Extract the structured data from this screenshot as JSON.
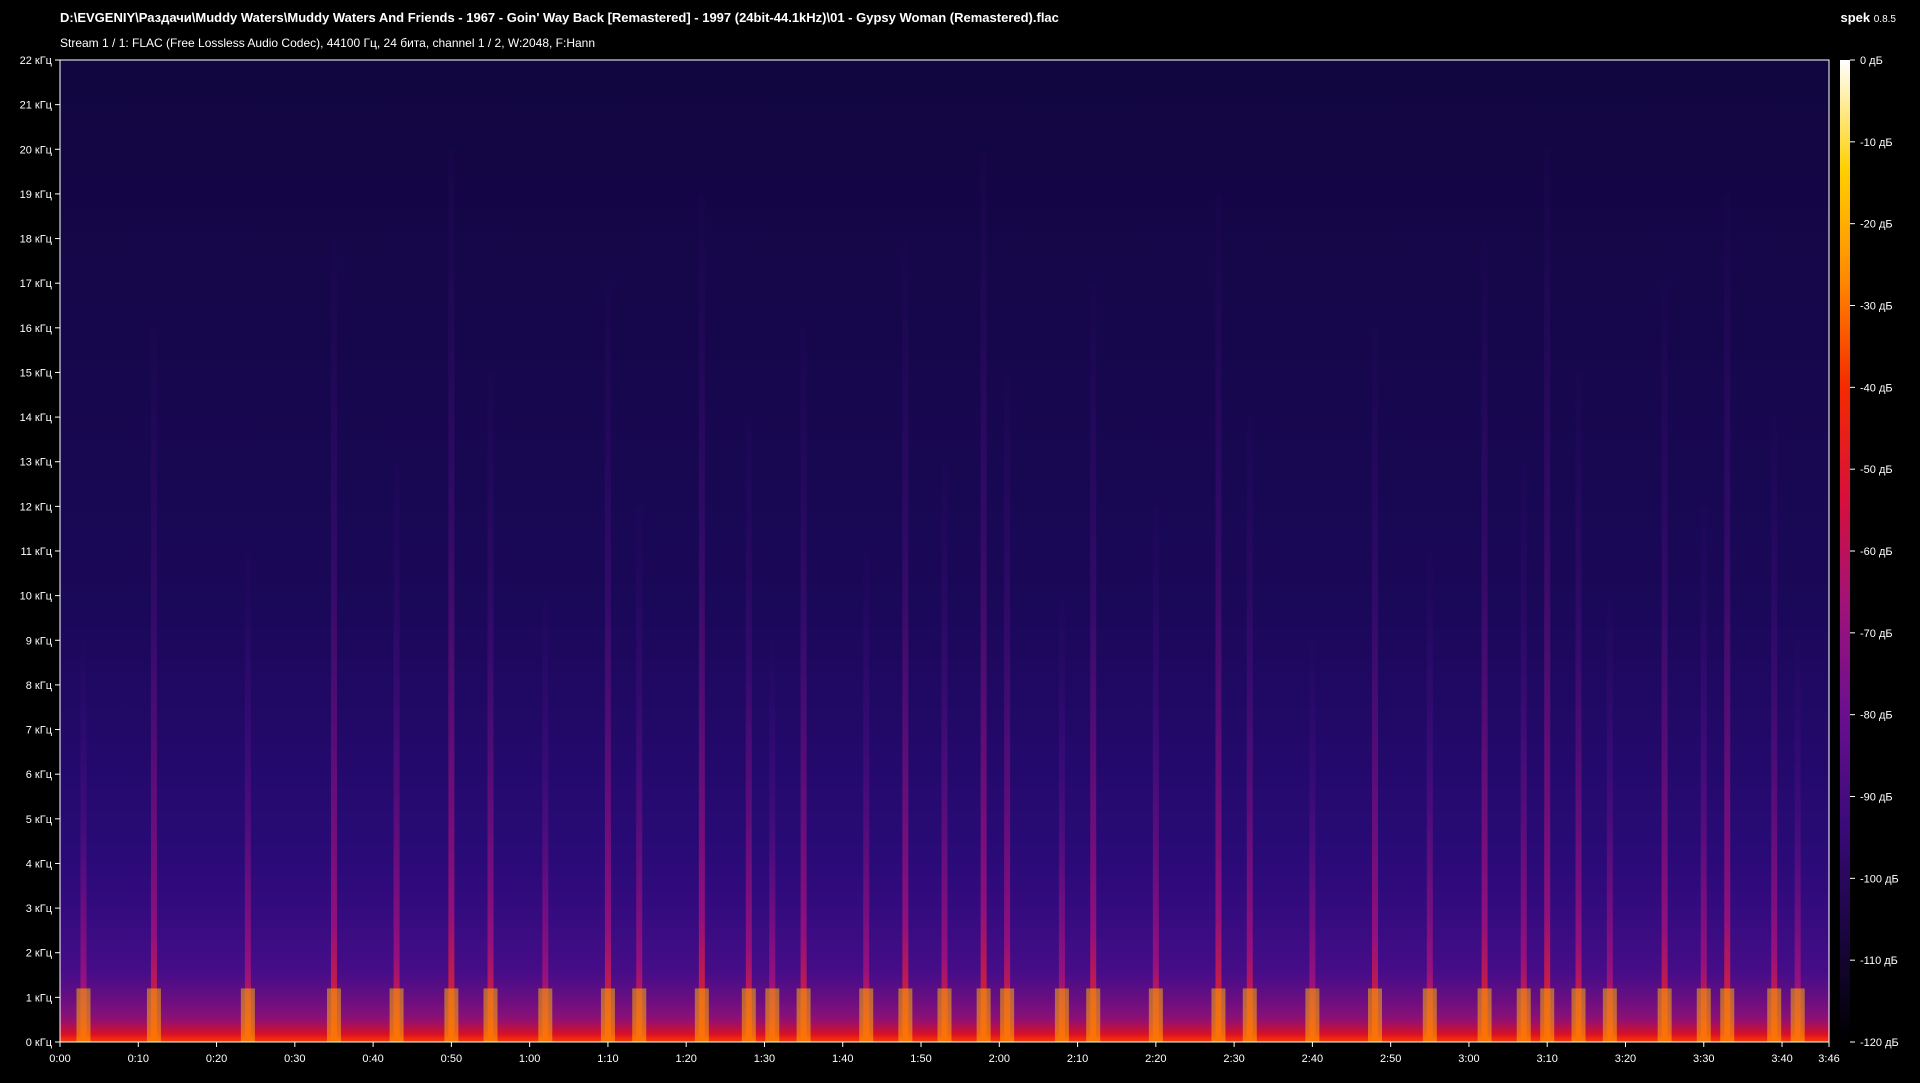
{
  "header": {
    "file_path": "D:\\EVGENIY\\Раздачи\\Muddy Waters\\Muddy Waters And Friends - 1967 - Goin' Way Back [Remastered] - 1997 (24bit-44.1kHz)\\01 - Gypsy Woman (Remastered).flac",
    "stream_info": "Stream 1 / 1: FLAC (Free Lossless Audio Codec), 44100 Гц, 24 бита, channel 1 / 2, W:2048, F:Hann",
    "app_name": "spek",
    "app_version": "0.8.5"
  },
  "chart_data": {
    "type": "heatmap",
    "title": "",
    "xlabel": "",
    "ylabel": "",
    "x_ticks": [
      "0:00",
      "0:10",
      "0:20",
      "0:30",
      "0:40",
      "0:50",
      "1:00",
      "1:10",
      "1:20",
      "1:30",
      "1:40",
      "1:50",
      "2:00",
      "2:10",
      "2:20",
      "2:30",
      "2:40",
      "2:50",
      "3:00",
      "3:10",
      "3:20",
      "3:30",
      "3:40",
      "3:46"
    ],
    "x_tick_seconds": [
      0,
      10,
      20,
      30,
      40,
      50,
      60,
      70,
      80,
      90,
      100,
      110,
      120,
      130,
      140,
      150,
      160,
      170,
      180,
      190,
      200,
      210,
      220,
      226
    ],
    "xlim_seconds": [
      0,
      226
    ],
    "y_ticks": [
      "0 кГц",
      "1 кГц",
      "2 кГц",
      "3 кГц",
      "4 кГц",
      "5 кГц",
      "6 кГц",
      "7 кГц",
      "8 кГц",
      "9 кГц",
      "10 кГц",
      "11 кГц",
      "12 кГц",
      "13 кГц",
      "14 кГц",
      "15 кГц",
      "16 кГц",
      "17 кГц",
      "18 кГц",
      "19 кГц",
      "20 кГц",
      "21 кГц",
      "22 кГц"
    ],
    "ylim_khz": [
      0,
      22
    ],
    "colorbar": {
      "labels": [
        "0 дБ",
        "-10 дБ",
        "-20 дБ",
        "-30 дБ",
        "-40 дБ",
        "-50 дБ",
        "-60 дБ",
        "-70 дБ",
        "-80 дБ",
        "-90 дБ",
        "-100 дБ",
        "-110 дБ",
        "-120 дБ"
      ],
      "range_db": [
        -120,
        0
      ],
      "colormap": [
        "#000000",
        "#1a0640",
        "#3a0a7a",
        "#6a0f8f",
        "#a0127a",
        "#d8103a",
        "#f52a00",
        "#ff8a00",
        "#ffd000",
        "#ffffff"
      ]
    },
    "peak_times_seconds": [
      3,
      12,
      24,
      35,
      43,
      50,
      55,
      62,
      70,
      74,
      82,
      88,
      91,
      95,
      103,
      108,
      113,
      118,
      121,
      128,
      132,
      140,
      148,
      152,
      160,
      168,
      175,
      182,
      187,
      190,
      194,
      198,
      205,
      210,
      213,
      219,
      222
    ]
  }
}
